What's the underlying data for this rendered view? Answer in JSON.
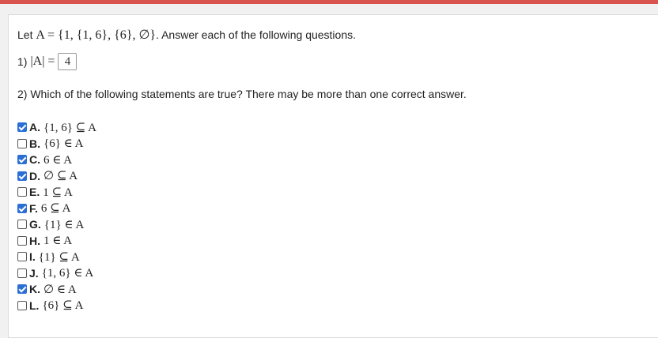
{
  "header": {
    "accent_color": "#d9534f"
  },
  "question": {
    "intro_prefix": "Let ",
    "set_expr": "A = {1, {1, 6}, {6}, ∅}",
    "intro_suffix": ". Answer each of the following questions."
  },
  "part1": {
    "label": "1) ",
    "expr": "|A| =",
    "answer_value": "4"
  },
  "part2": {
    "prompt": "2) Which of the following statements are true? There may be more than one correct answer.",
    "check_color": "#2b6fd6",
    "options": [
      {
        "letter": "A.",
        "expr": "{1, 6} ⊆ A",
        "checked": true
      },
      {
        "letter": "B.",
        "expr": "{6} ∈ A",
        "checked": false
      },
      {
        "letter": "C.",
        "expr": "6 ∈ A",
        "checked": true
      },
      {
        "letter": "D.",
        "expr": "∅ ⊆ A",
        "checked": true
      },
      {
        "letter": "E.",
        "expr": "1 ⊆ A",
        "checked": false
      },
      {
        "letter": "F.",
        "expr": "6 ⊆ A",
        "checked": true
      },
      {
        "letter": "G.",
        "expr": "{1} ∈ A",
        "checked": false
      },
      {
        "letter": "H.",
        "expr": "1 ∈ A",
        "checked": false
      },
      {
        "letter": "I.",
        "expr": "{1} ⊆ A",
        "checked": false
      },
      {
        "letter": "J.",
        "expr": "{1, 6} ∈ A",
        "checked": false
      },
      {
        "letter": "K.",
        "expr": "∅ ∈ A",
        "checked": true
      },
      {
        "letter": "L.",
        "expr": "{6} ⊆ A",
        "checked": false
      }
    ]
  }
}
